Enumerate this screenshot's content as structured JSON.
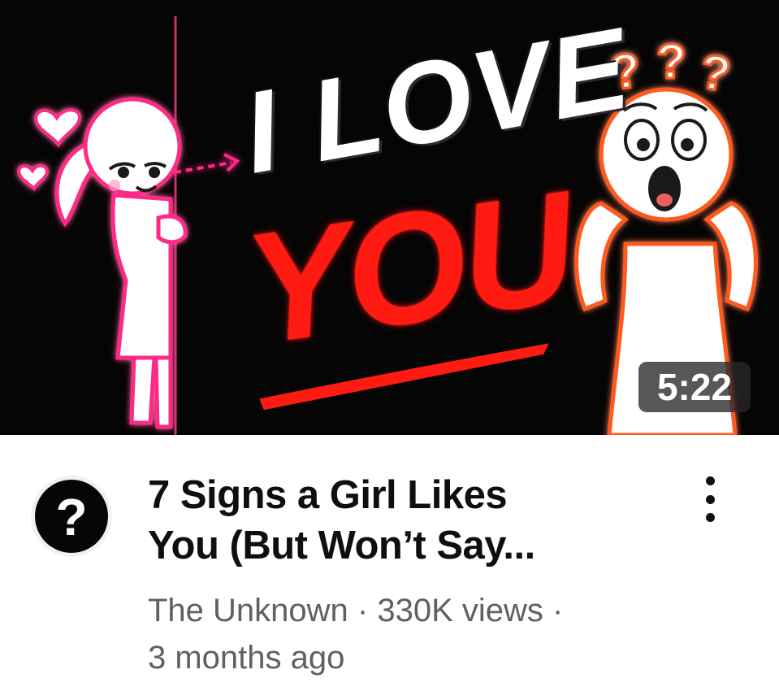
{
  "video": {
    "thumbnail": {
      "headline_top": "I LOVE",
      "headline_bottom": "YOU",
      "question_marks": "???",
      "colors": {
        "background": "#050505",
        "love": "#ffffff",
        "you": "#ff1a12",
        "girl_glow": "#ff2a88",
        "guy_glow": "#ff5a1e"
      }
    },
    "duration": "5:22",
    "title_line1": "7 Signs a Girl Likes",
    "title_line2": "You (But Won’t Say...",
    "channel": "The Unknown",
    "separator": " · ",
    "views": "330K views",
    "age": "3 months ago",
    "avatar_glyph": "?",
    "more_actions_icon": "more-vertical-icon"
  }
}
